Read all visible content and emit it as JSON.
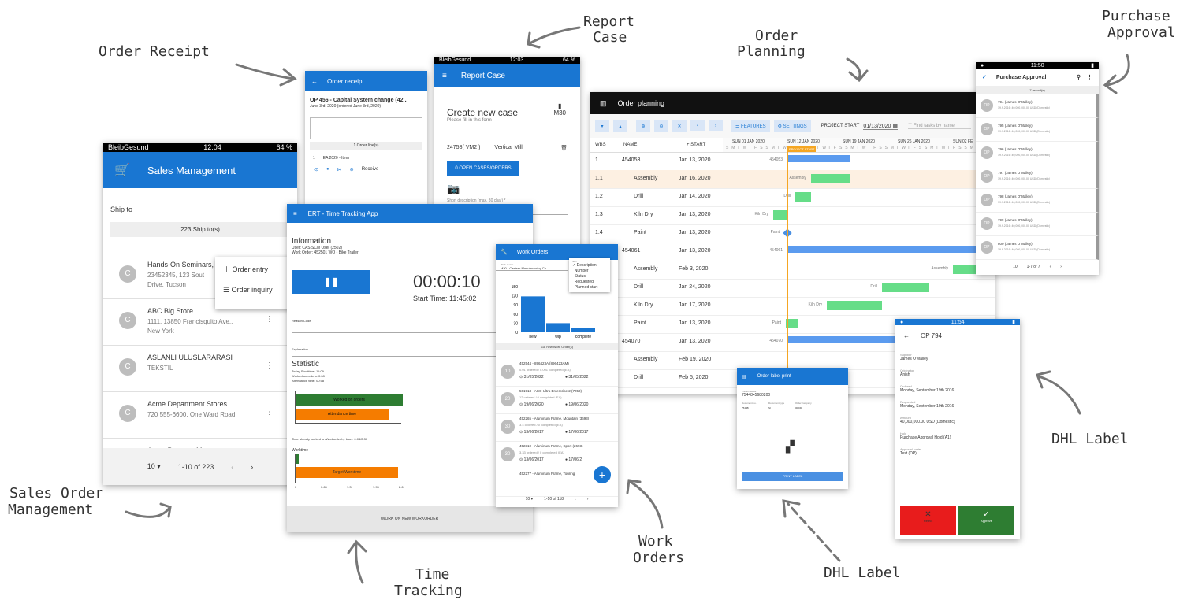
{
  "labels": {
    "order_receipt": "Order Receipt",
    "report_case": [
      "Report",
      "Case"
    ],
    "order_planning": [
      "Order",
      "Planning"
    ],
    "purchase_approval": [
      "Purchase",
      "Approval"
    ],
    "sales_order": [
      "Sales Order",
      "Management"
    ],
    "time_tracking": [
      "Time",
      "Tracking"
    ],
    "work_orders": [
      "Work",
      "Orders"
    ],
    "dhl_label_bottom": "DHL Label",
    "dhl_label_right": "DHL Label"
  },
  "sales": {
    "status_left": "BleibGesund",
    "status_time": "12:04",
    "status_batt": "64 %",
    "title": "Sales Management",
    "ship_to_label": "Ship to",
    "ship_count": "223 Ship to(s)",
    "menu": [
      "Order entry",
      "Order inquiry"
    ],
    "customers": [
      {
        "name": "Hands-On Seminars,",
        "addr1": "23452345, 123 Sout",
        "addr2": "Drive, Tucson"
      },
      {
        "name": "ABC Big Store",
        "addr1": "1111, 13850 Francisquito Ave.,",
        "addr2": "New York"
      },
      {
        "name": "ASLANLI ULUSLARARASI",
        "addr1": "TEKSTIL",
        "addr2": ""
      },
      {
        "name": "Acme Department Stores",
        "addr1": "720 555-6600, One Ward Road",
        "addr2": ""
      },
      {
        "name": "Acme Property Managers",
        "addr1": "1600 Karen Place",
        "addr2": ""
      }
    ],
    "pager_size": "10",
    "pager_range": "1-10 of 223"
  },
  "receipt": {
    "title": "Order receipt",
    "order": "OP 456 - Capital System change (42...",
    "date": "June 3rd, 2020 (ordered June 3rd, 2020)",
    "lines": "1 Order line(s)",
    "qty": "1",
    "item": "EA  2020 - Item",
    "receive": "Receive"
  },
  "report": {
    "status_left": "BleibGesund",
    "status_time": "12:03",
    "status_batt": "64 %",
    "title": "Report Case",
    "heading": "Create new case",
    "sub": "Please fill in this form",
    "code": "M30",
    "machine_id": "24758( VM2 )",
    "machine": "Vertical Mill",
    "button": "0 OPEN CASES/ORDERS",
    "desc": "Short description (max. 80 char) *"
  },
  "planning": {
    "title": "Order planning",
    "features": "FEATURES",
    "settings": "SETTINGS",
    "project_start_label": "PROJECT START",
    "project_start": "01/13/2020",
    "search_placeholder": "Find tasks by name",
    "columns": [
      "WBS",
      "NAME",
      "START"
    ],
    "weeks": [
      "SUN 01 JAN 2020",
      "SUN 12 JAN 2020",
      "SUN 19 JAN 2020",
      "SUN 26 JAN 2020",
      "SUN 02 FE"
    ],
    "project_start_flag": "PROJECT START",
    "rows": [
      {
        "wbs": "1",
        "name": "454053",
        "start": "Jan 13, 2020",
        "bar": "454053"
      },
      {
        "wbs": "1.1",
        "name": "Assembly",
        "start": "Jan 16, 2020",
        "bar": "Assembly"
      },
      {
        "wbs": "1.2",
        "name": "Drill",
        "start": "Jan 14, 2020",
        "bar": "Drill"
      },
      {
        "wbs": "1.3",
        "name": "Kiln Dry",
        "start": "Jan 13, 2020",
        "bar": "Kiln Dry"
      },
      {
        "wbs": "1.4",
        "name": "Paint",
        "start": "Jan 13, 2020",
        "bar": "Paint"
      },
      {
        "wbs": "2",
        "name": "454061",
        "start": "Jan 13, 2020",
        "bar": "454061"
      },
      {
        "wbs": "",
        "name": "Assembly",
        "start": "Feb 3, 2020",
        "bar": "Assembly"
      },
      {
        "wbs": "",
        "name": "Drill",
        "start": "Jan 24, 2020",
        "bar": "Drill"
      },
      {
        "wbs": "",
        "name": "Kiln Dry",
        "start": "Jan 17, 2020",
        "bar": "Kiln Dry"
      },
      {
        "wbs": "",
        "name": "Paint",
        "start": "Jan 13, 2020",
        "bar": "Paint"
      },
      {
        "wbs": "",
        "name": "454070",
        "start": "Jan 13, 2020",
        "bar": "454070"
      },
      {
        "wbs": "",
        "name": "Assembly",
        "start": "Feb 19, 2020",
        "bar": ""
      },
      {
        "wbs": "",
        "name": "Drill",
        "start": "Feb 5, 2020",
        "bar": ""
      }
    ]
  },
  "purchase": {
    "title": "Purchase Approval",
    "records": "7 record(s)",
    "items": [
      {
        "title": "794 (James O'Malley)",
        "sub": "19.9.2016: 40,000,000.00 USD (Domestic)"
      },
      {
        "title": "795 (James O'Malley)",
        "sub": "19.9.2016: 40,000,000.00 USD (Domestic)"
      },
      {
        "title": "796 (James O'Malley)",
        "sub": "19.9.2016: 40,000,000.00 USD (Domestic)"
      },
      {
        "title": "797 (James O'Malley)",
        "sub": "19.9.2016: 40,000,000.00 USD (Domestic)"
      },
      {
        "title": "798 (James O'Malley)",
        "sub": "19.9.2016: 40,000,000.00 USD (Domestic)"
      },
      {
        "title": "799 (James O'Malley)",
        "sub": "19.9.2016: 40,000,000.00 USD (Domestic)"
      },
      {
        "title": "800 (James O'Malley)",
        "sub": "19.9.2016: 40,000,000.00 USD (Domestic)"
      }
    ],
    "pager": "10",
    "range": "1-7 of 7"
  },
  "time": {
    "title": "ERT - Time Tracking App",
    "info_title": "Information",
    "user": "User: CAS SCM User (2502)",
    "work_order": "Work Order: 452501 WO - Bike Trailer",
    "timer": "00:00:10",
    "start_time": "Start Time: 11:45:02",
    "reason": "Reason Code",
    "explanation": "Explanation",
    "stat_title": "Statistic",
    "stat1": "Today Shorttime: 11:09",
    "stat2": "Worked on orders: 0:08",
    "stat3": "Attendance time: 00:08",
    "bar1": "Worked on orders",
    "bar2": "Attendance time",
    "already": "Time already worked on Workorder by User: 0:04/2:30",
    "workt": "Worktime",
    "target": "Target Worktime",
    "axis": [
      "0",
      "0.65",
      "1.3",
      "1.95",
      "2.6"
    ],
    "bottom": "WORK ON NEW WORKORDER"
  },
  "work": {
    "title": "Work Orders",
    "workcenter": "M30 - Castern Manufacturing Ce",
    "sort_options": [
      "Description",
      "Number",
      "Status",
      "Requested",
      "Planned start"
    ],
    "sort_selected": "Description",
    "yaxis": [
      "150",
      "120",
      "90",
      "60",
      "30",
      "0"
    ],
    "chart_caption": "118 new Work Order(s)",
    "orders": [
      {
        "badge": "10",
        "title": "452544 - 896423A (896423AM)",
        "sub": "0.01 ordered / 0.001 completed (EA)",
        "d1": "31/05/2022",
        "d2": "31/05/2022"
      },
      {
        "badge": "20",
        "title": "501913 - ACO Ultra Enterprise 2 (7250)",
        "sub": "12 ordered / 0 completed (EA)",
        "d1": "19/06/2020",
        "d2": "19/06/2020"
      },
      {
        "badge": "30",
        "title": "452265 - Aluminum Frame, Mountain (3693)",
        "sub": "3.4 ordered / 0 completed (EA)",
        "d1": "13/06/2017",
        "d2": "17/06/2017"
      },
      {
        "badge": "30",
        "title": "452310 - Aluminum Frame, Sport (2693)",
        "sub": "3.33 ordered / 0 completed (EA)",
        "d1": "13/06/2017",
        "d2": "17/06/2"
      },
      {
        "badge": "",
        "title": "452277 - Aluminum Frame, Touring",
        "sub": "",
        "d1": "",
        "d2": ""
      }
    ],
    "pager": "10",
    "range": "1-10 of 118"
  },
  "dhl": {
    "title": "Order label print",
    "printer_label": "Printer device",
    "printer": "7544845680200",
    "cols": [
      "Document no.",
      "Document type",
      "Order company"
    ],
    "vals": [
      "7544B",
      "SI",
      "00030"
    ],
    "button": "PRINT LABEL"
  },
  "op794": {
    "title": "OP 794",
    "fields": [
      {
        "k": "Supplier",
        "v": "James O'Malley"
      },
      {
        "k": "Originator",
        "v": "Anish"
      },
      {
        "k": "Ordered",
        "v": "Monday, September 19th 2016"
      },
      {
        "k": "Requested",
        "v": "Monday, September 19th 2016"
      },
      {
        "k": "Amount",
        "v": "40,000,000.00 USD (Domestic)"
      },
      {
        "k": "Hold",
        "v": "Purchase Approval Hold (A1)"
      },
      {
        "k": "Approval route",
        "v": "Test (DP)"
      }
    ],
    "reject": "Reject",
    "approve": "Approve"
  },
  "chart_data": {
    "type": "bar",
    "categories": [
      "new",
      "wip",
      "complete"
    ],
    "values": [
      118,
      30,
      14
    ],
    "ylim": [
      0,
      150
    ]
  },
  "colors": {
    "blue": "#1976d2",
    "green": "#2e7d32",
    "red": "#e81c1c",
    "orange": "#f57c00",
    "gantt_green": "#66dd88"
  }
}
